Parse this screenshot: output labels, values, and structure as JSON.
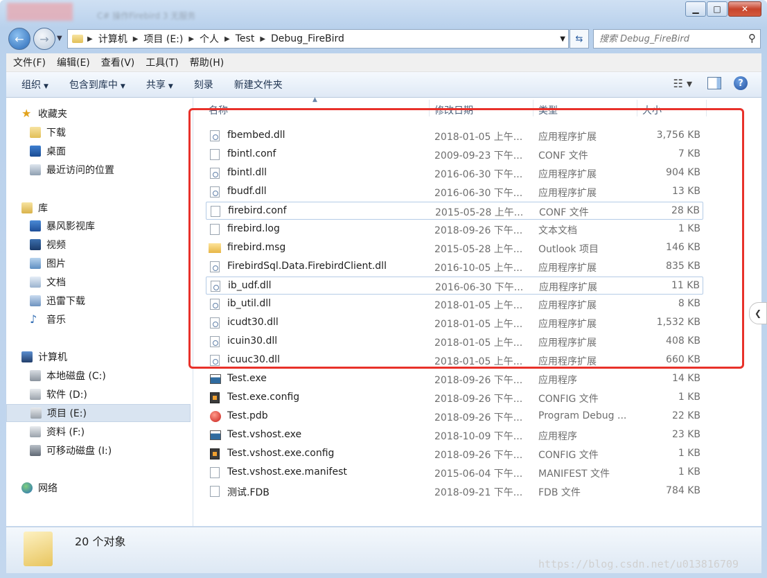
{
  "window": {
    "title": "C# 操作Firebird 3 无服务",
    "buttons": {
      "minimize": "▁",
      "maximize": "□",
      "close": "✕"
    }
  },
  "address": {
    "crumbs": [
      "计算机",
      "项目 (E:)",
      "个人",
      "Test",
      "Debug_FireBird"
    ],
    "search_placeholder": "搜索 Debug_FireBird"
  },
  "menu": [
    "文件(F)",
    "编辑(E)",
    "查看(V)",
    "工具(T)",
    "帮助(H)"
  ],
  "toolbar": {
    "organize": "组织",
    "include": "包含到库中",
    "share": "共享",
    "burn": "刻录",
    "new_folder": "新建文件夹"
  },
  "sidebar": {
    "favorites": "收藏夹",
    "fav_items": [
      "下载",
      "桌面",
      "最近访问的位置"
    ],
    "libraries": "库",
    "lib_items": [
      "暴风影视库",
      "视频",
      "图片",
      "文档",
      "迅雷下载",
      "音乐"
    ],
    "computer": "计算机",
    "drives": [
      "本地磁盘 (C:)",
      "软件 (D:)",
      "项目 (E:)",
      "资料 (F:)",
      "可移动磁盘 (I:)"
    ],
    "network": "网络"
  },
  "columns": {
    "name": "名称",
    "date": "修改日期",
    "type": "类型",
    "size": "大小"
  },
  "files": [
    {
      "name": "fbembed.dll",
      "date": "2018-01-05 上午...",
      "type": "应用程序扩展",
      "size": "3,756 KB",
      "icon": "dll"
    },
    {
      "name": "fbintl.conf",
      "date": "2009-09-23 下午...",
      "type": "CONF 文件",
      "size": "7 KB",
      "icon": "doc"
    },
    {
      "name": "fbintl.dll",
      "date": "2016-06-30 下午...",
      "type": "应用程序扩展",
      "size": "904 KB",
      "icon": "dll"
    },
    {
      "name": "fbudf.dll",
      "date": "2016-06-30 下午...",
      "type": "应用程序扩展",
      "size": "13 KB",
      "icon": "dll"
    },
    {
      "name": "firebird.conf",
      "date": "2015-05-28 上午...",
      "type": "CONF 文件",
      "size": "28 KB",
      "icon": "doc"
    },
    {
      "name": "firebird.log",
      "date": "2018-09-26 下午...",
      "type": "文本文档",
      "size": "1 KB",
      "icon": "doc"
    },
    {
      "name": "firebird.msg",
      "date": "2015-05-28 上午...",
      "type": "Outlook 项目",
      "size": "146 KB",
      "icon": "msg"
    },
    {
      "name": "FirebirdSql.Data.FirebirdClient.dll",
      "date": "2016-10-05 上午...",
      "type": "应用程序扩展",
      "size": "835 KB",
      "icon": "dll"
    },
    {
      "name": "ib_udf.dll",
      "date": "2016-06-30 下午...",
      "type": "应用程序扩展",
      "size": "11 KB",
      "icon": "dll"
    },
    {
      "name": "ib_util.dll",
      "date": "2018-01-05 上午...",
      "type": "应用程序扩展",
      "size": "8 KB",
      "icon": "dll"
    },
    {
      "name": "icudt30.dll",
      "date": "2018-01-05 上午...",
      "type": "应用程序扩展",
      "size": "1,532 KB",
      "icon": "dll"
    },
    {
      "name": "icuin30.dll",
      "date": "2018-01-05 上午...",
      "type": "应用程序扩展",
      "size": "408 KB",
      "icon": "dll"
    },
    {
      "name": "icuuc30.dll",
      "date": "2018-01-05 上午...",
      "type": "应用程序扩展",
      "size": "660 KB",
      "icon": "dll"
    },
    {
      "name": "Test.exe",
      "date": "2018-09-26 下午...",
      "type": "应用程序",
      "size": "14 KB",
      "icon": "exe"
    },
    {
      "name": "Test.exe.config",
      "date": "2018-09-26 下午...",
      "type": "CONFIG 文件",
      "size": "1 KB",
      "icon": "cfg"
    },
    {
      "name": "Test.pdb",
      "date": "2018-09-26 下午...",
      "type": "Program Debug ...",
      "size": "22 KB",
      "icon": "pdb"
    },
    {
      "name": "Test.vshost.exe",
      "date": "2018-10-09 下午...",
      "type": "应用程序",
      "size": "23 KB",
      "icon": "exe"
    },
    {
      "name": "Test.vshost.exe.config",
      "date": "2018-09-26 下午...",
      "type": "CONFIG 文件",
      "size": "1 KB",
      "icon": "cfg"
    },
    {
      "name": "Test.vshost.exe.manifest",
      "date": "2015-06-04 下午...",
      "type": "MANIFEST 文件",
      "size": "1 KB",
      "icon": "doc"
    },
    {
      "name": "测试.FDB",
      "date": "2018-09-21 下午...",
      "type": "FDB 文件",
      "size": "784 KB",
      "icon": "doc"
    }
  ],
  "status": {
    "count": "20 个对象"
  },
  "watermark": "https://blog.csdn.net/u013816709",
  "colors": {
    "highlight_box": "#e8312a",
    "selection": "#d9e4f1"
  }
}
